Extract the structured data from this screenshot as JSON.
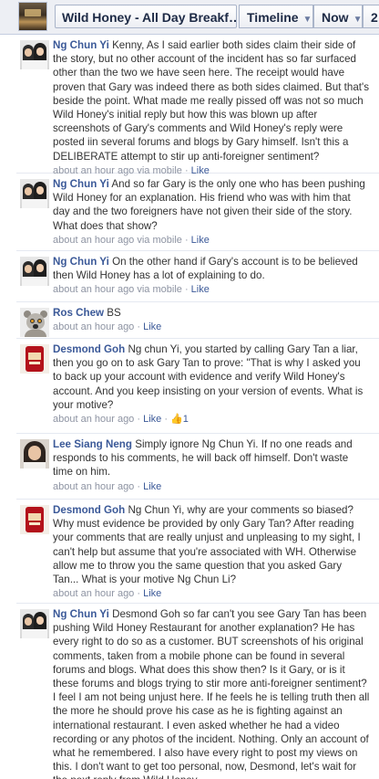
{
  "header": {
    "page_title": "Wild Honey - All Day Breakf…",
    "nav": [
      {
        "label": "Timeline",
        "icon": "caret-down-icon"
      },
      {
        "label": "Now",
        "icon": "caret-down-icon"
      },
      {
        "label": "2"
      }
    ]
  },
  "comments": [
    {
      "author": "Ng Chun Yi",
      "text": " Kenny, As I said earlier both sides claim their side of the story, but no other account of the incident has so far surfaced other than the two we have seen here. The receipt would have proven that Gary was indeed there as both sides claimed. But that's beside the point. What made me really pissed off was not so much Wild Honey's initial reply but how this was blown up after screenshots of Gary's comments and Wild Honey's reply were posted iin several forums and blogs by Gary himself. Isn't this a DELIBERATE attempt to stir up anti-foreigner sentiment?",
      "time": "about an hour ago via mobile",
      "sep": " · ",
      "like": "Like",
      "avatar": "couple"
    },
    {
      "author": "Ng Chun Yi",
      "text": " And so far Gary is the only one who has been pushing Wild Honey for an explanation. His friend who was with him that day and the two foreigners have not given their side of the story. What does that show?",
      "time": "about an hour ago via mobile",
      "sep": " · ",
      "like": "Like",
      "avatar": "couple"
    },
    {
      "author": "Ng Chun Yi",
      "text": " On the other hand if Gary's account is to be believed then Wild Honey has a lot of explaining to do.",
      "time": "about an hour ago via mobile",
      "sep": " · ",
      "like": "Like",
      "avatar": "couple"
    },
    {
      "author": "Ros Chew",
      "text": " BS",
      "time": "about an hour ago",
      "sep": " · ",
      "like": "Like",
      "avatar": "lemur"
    },
    {
      "author": "Desmond Goh",
      "text": " Ng chun Yi, you started by calling Gary Tan a liar, then you go on to ask Gary Tan to prove: \"That is why I asked you to back up your account with evidence and verify Wild Honey's account. And you keep insisting on your version of events. What is your motive?",
      "time": "about an hour ago",
      "sep": " · ",
      "like": "Like",
      "likes_count": "1",
      "avatar": "can"
    },
    {
      "author": "Lee Siang Neng",
      "text": " Simply ignore Ng Chun Yi. If no one reads and responds to his comments, he will back off himself. Don't waste time on him.",
      "time": "about an hour ago",
      "sep": " · ",
      "like": "Like",
      "avatar": "woman"
    },
    {
      "author": "Desmond Goh",
      "text": " Ng Chun Yi, why are your comments so biased? Why must evidence be provided by only Gary Tan? After reading your comments that are really unjust and unpleasing to my sight, I can't help but assume that you're associated with WH. Otherwise allow me to throw you the same question that you asked Gary Tan... What is your motive Ng Chun Li?",
      "time": "about an hour ago",
      "sep": " · ",
      "like": "Like",
      "avatar": "can"
    },
    {
      "author": "Ng Chun Yi",
      "text": " Desmond Goh so far can't you see Gary Tan has been pushing Wild Honey Restaurant for another explanation? He has every right to do so as a customer. BUT screenshots of his original comments, taken from a mobile phone can be found in several forums and blogs. What does this show then? Is it Gary, or is it these forums and blogs trying to stir more anti-foreigner sentiment? I feel I am not being unjust here. If he feels he is telling truth then all the more he should prove his case as he is fighting against an international restaurant. I even asked whether he had a video recording or any photos of the incident. Nothing. Only an account of what he remembered. I also have every right to post my views on this. I don't want to get too personal, now, Desmond, let's wait for the next reply from Wild Honey.",
      "avatar": "couple"
    }
  ]
}
